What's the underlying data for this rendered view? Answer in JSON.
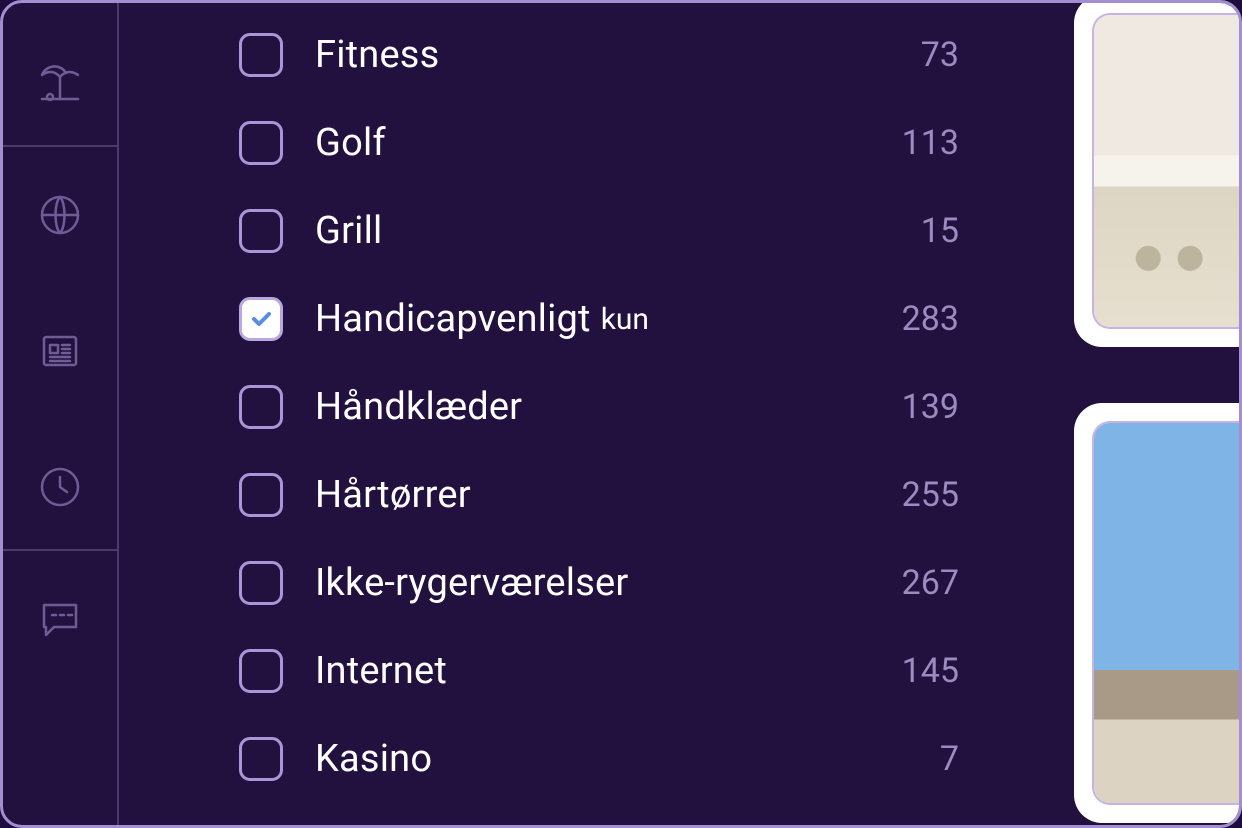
{
  "sidebar": {
    "items": [
      {
        "name": "beach-icon"
      },
      {
        "name": "globe-icon"
      },
      {
        "name": "news-icon"
      },
      {
        "name": "clock-icon"
      },
      {
        "name": "chat-icon"
      }
    ]
  },
  "filters": {
    "items": [
      {
        "label": "Fitness",
        "count": "73",
        "checked": false,
        "suffix": ""
      },
      {
        "label": "Golf",
        "count": "113",
        "checked": false,
        "suffix": ""
      },
      {
        "label": "Grill",
        "count": "15",
        "checked": false,
        "suffix": ""
      },
      {
        "label": "Handicapvenligt",
        "count": "283",
        "checked": true,
        "suffix": "kun"
      },
      {
        "label": "Håndklæder",
        "count": "139",
        "checked": false,
        "suffix": ""
      },
      {
        "label": "Hårtørrer",
        "count": "255",
        "checked": false,
        "suffix": ""
      },
      {
        "label": "Ikke-rygerværelser",
        "count": "267",
        "checked": false,
        "suffix": ""
      },
      {
        "label": "Internet",
        "count": "145",
        "checked": false,
        "suffix": ""
      },
      {
        "label": "Kasino",
        "count": "7",
        "checked": false,
        "suffix": ""
      }
    ]
  },
  "colors": {
    "bg": "#22103f",
    "border": "#a38ed2",
    "text": "#ffffff",
    "muted": "#9c8bc0",
    "iconMuted": "#6f5c94",
    "checkboxBorder": "#a996d8",
    "checkmark": "#5a8de0"
  }
}
